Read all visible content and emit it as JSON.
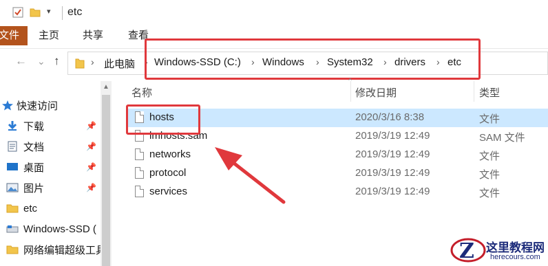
{
  "title_bar": {
    "title": "etc",
    "icons": [
      "checkbox-icon",
      "folder-icon",
      "dropdown-icon"
    ]
  },
  "ribbon": {
    "file_tab": "文件",
    "tabs": [
      "主页",
      "共享",
      "查看"
    ]
  },
  "nav_buttons": {
    "back": "←",
    "forward": "→",
    "recent": "⌄",
    "up": "↑"
  },
  "address_bar": {
    "root": "此电脑",
    "crumbs": [
      "Windows-SSD (C:)",
      "Windows",
      "System32",
      "drivers",
      "etc"
    ]
  },
  "left_pane": {
    "items": [
      {
        "label": "快速访问",
        "icon": "star-icon",
        "pinned": false
      },
      {
        "label": "下载",
        "icon": "download-icon",
        "pinned": true
      },
      {
        "label": "文档",
        "icon": "document-icon",
        "pinned": true
      },
      {
        "label": "桌面",
        "icon": "desktop-icon",
        "pinned": true
      },
      {
        "label": "图片",
        "icon": "pictures-icon",
        "pinned": true
      },
      {
        "label": "etc",
        "icon": "folder-icon",
        "pinned": false
      },
      {
        "label": "Windows-SSD (",
        "icon": "drive-icon",
        "pinned": false
      },
      {
        "label": "网络编辑超级工具",
        "icon": "folder-icon",
        "pinned": false
      }
    ]
  },
  "columns": {
    "name": "名称",
    "date": "修改日期",
    "type": "类型"
  },
  "files": [
    {
      "name": "hosts",
      "date": "2020/3/16 8:38",
      "type": "文件",
      "selected": true
    },
    {
      "name": "lmhosts.sam",
      "date": "2019/3/19 12:49",
      "type": "SAM 文件",
      "selected": false
    },
    {
      "name": "networks",
      "date": "2019/3/19 12:49",
      "type": "文件",
      "selected": false
    },
    {
      "name": "protocol",
      "date": "2019/3/19 12:49",
      "type": "文件",
      "selected": false
    },
    {
      "name": "services",
      "date": "2019/3/19 12:49",
      "type": "文件",
      "selected": false
    }
  ],
  "watermark": {
    "title": "这里教程网",
    "url": "herecours.com"
  },
  "colors": {
    "accent_file_tab": "#b3531c",
    "selection": "#cce8ff",
    "annotation_red": "#e0383c"
  }
}
